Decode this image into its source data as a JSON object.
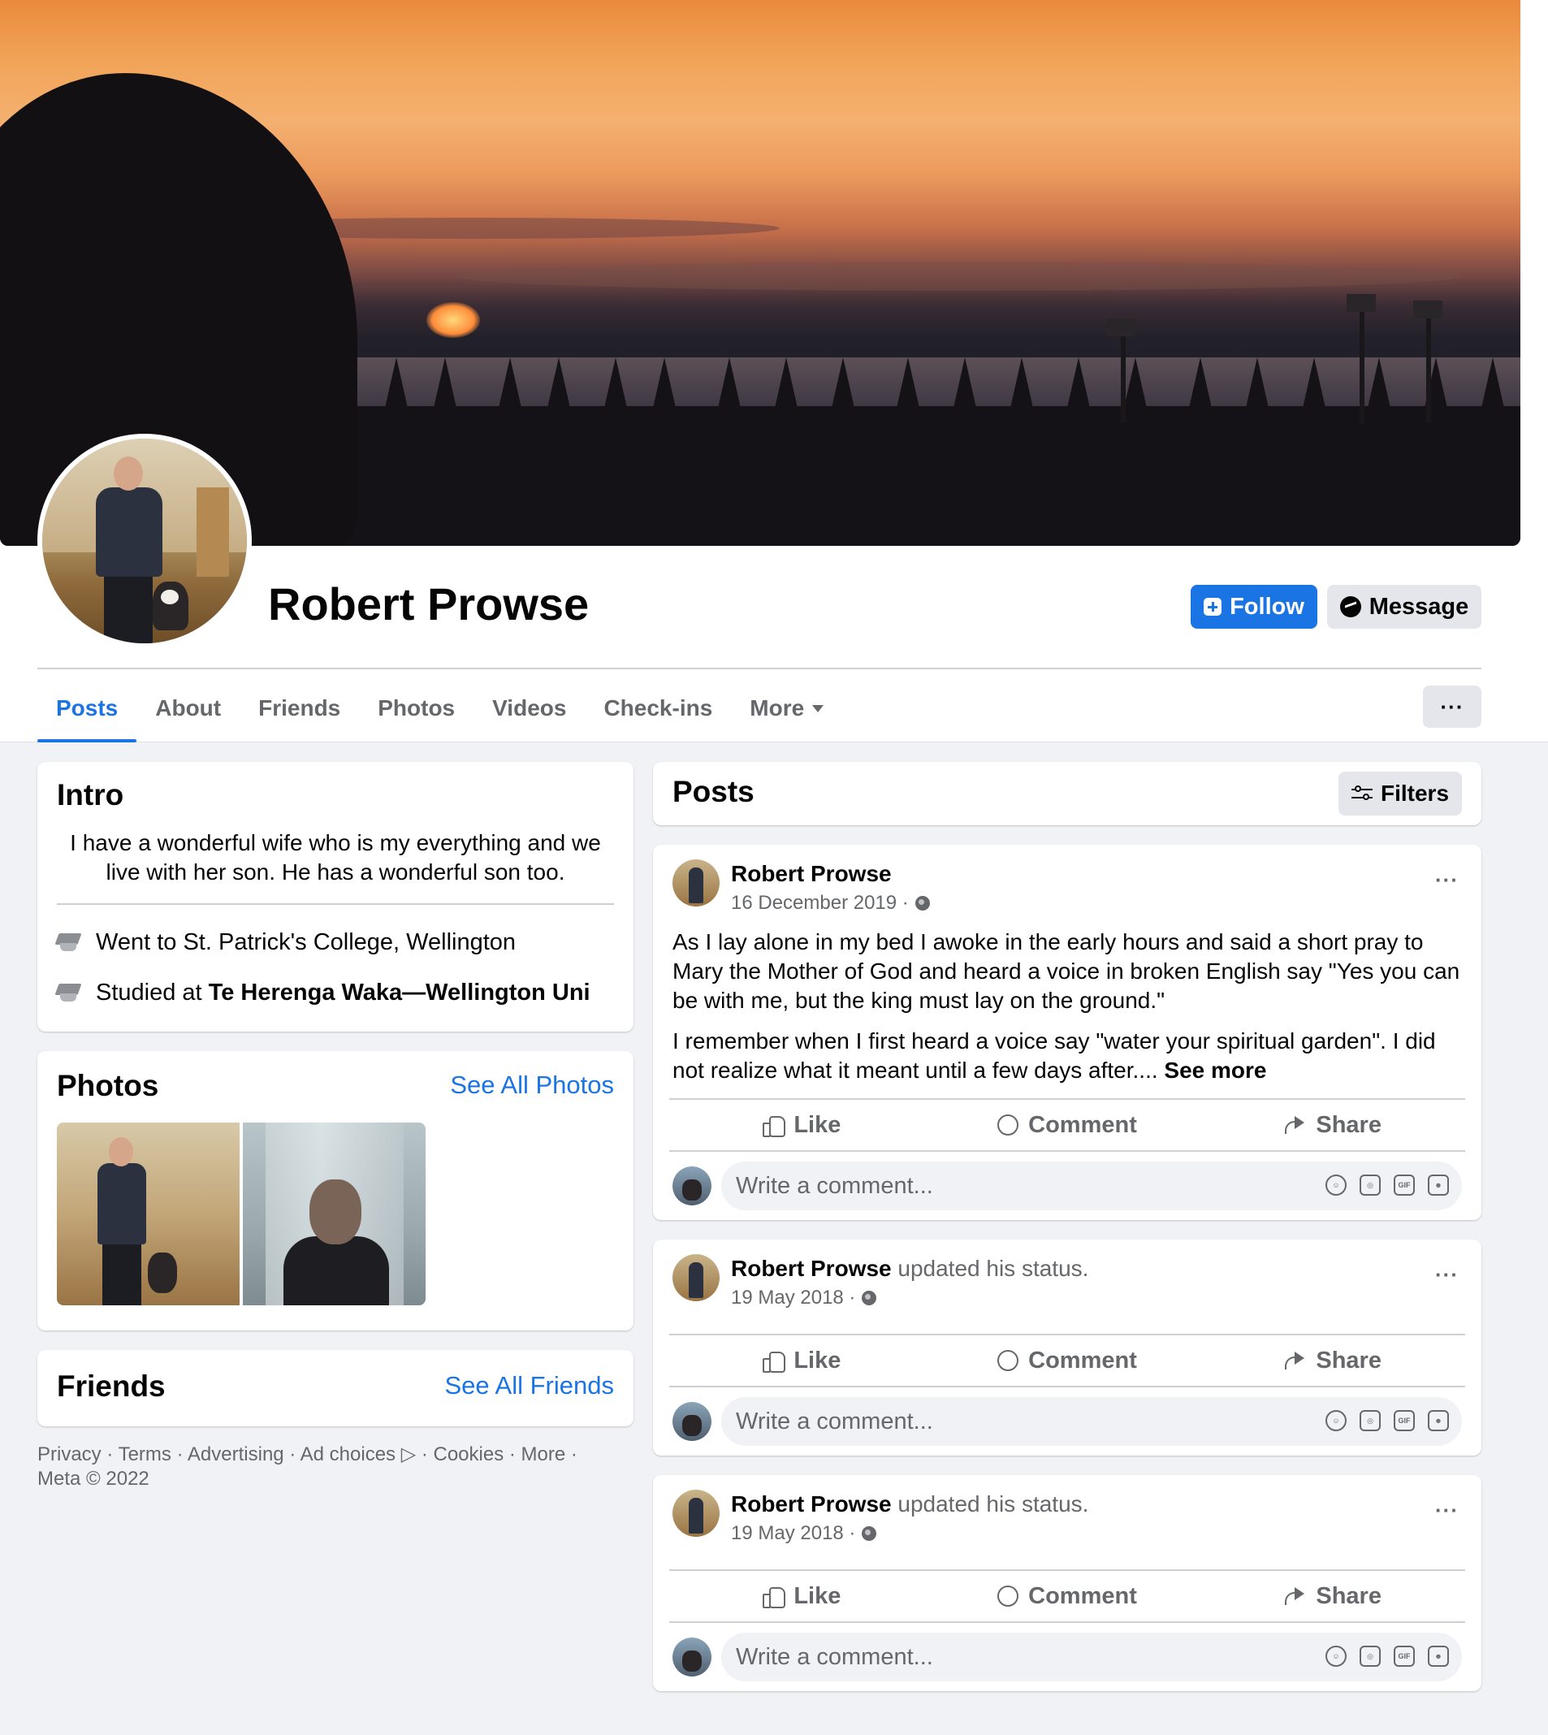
{
  "profile": {
    "name": "Robert Prowse",
    "follow_label": "Follow",
    "message_label": "Message"
  },
  "tabs": [
    {
      "label": "Posts",
      "active": true
    },
    {
      "label": "About"
    },
    {
      "label": "Friends"
    },
    {
      "label": "Photos"
    },
    {
      "label": "Videos"
    },
    {
      "label": "Check-ins"
    },
    {
      "label": "More"
    }
  ],
  "tabs_more_button": "···",
  "intro": {
    "title": "Intro",
    "bio": "I have a wonderful wife who is my everything and we live with her son. He has a wonderful son too.",
    "education": [
      {
        "prefix": "Went to ",
        "school": "St. Patrick's College, Wellington"
      },
      {
        "prefix": "Studied at ",
        "school": "Te Herenga Waka—Wellington Uni"
      }
    ]
  },
  "photos": {
    "title": "Photos",
    "see_all": "See All Photos"
  },
  "friends": {
    "title": "Friends",
    "see_all": "See All Friends"
  },
  "footer": {
    "line1": "Privacy · Terms · Advertising · Ad choices ▷ · Cookies · More ·",
    "line2": "Meta © 2022"
  },
  "posts_section": {
    "title": "Posts",
    "filters_label": "Filters"
  },
  "posts": [
    {
      "author": "Robert Prowse",
      "action": "",
      "date": "16 December 2019 ·",
      "paragraph1": "As I lay alone in my bed I awoke in the early hours and said a short pray to Mary the Mother of God and heard a voice in broken English say \"Yes you can be with me, but the king must lay on the ground.\"",
      "paragraph2": "I remember when I first heard a voice say \"water your spiritual garden\". I did not realize what it meant until a few days after.... ",
      "see_more": "See more"
    },
    {
      "author": "Robert Prowse",
      "action": " updated his status.",
      "date": "19 May 2018 ·"
    },
    {
      "author": "Robert Prowse",
      "action": " updated his status.",
      "date": "19 May 2018 ·"
    }
  ],
  "post_actions": {
    "like": "Like",
    "comment": "Comment",
    "share": "Share",
    "more": "···"
  },
  "comment_box": {
    "placeholder": "Write a comment...",
    "gif_label": "GIF"
  },
  "icons": {
    "follow": "follow-plus-icon",
    "message": "messenger-icon",
    "education": "graduation-cap-icon",
    "privacy": "globe-icon",
    "filters": "sliders-icon"
  },
  "colors": {
    "accent": "#1b74e4",
    "background": "#f0f2f5",
    "secondary_text": "#65676b"
  }
}
